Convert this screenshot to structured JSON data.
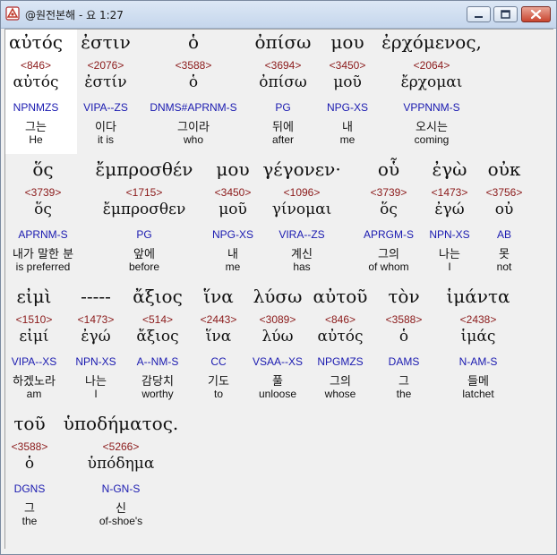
{
  "window": {
    "title": "@원전본해 - 요 1:27",
    "colors": {
      "strong": "#8b1a1a",
      "morph": "#1a1ab0",
      "text": "#111111"
    }
  },
  "verse": {
    "rows": [
      {
        "words": [
          {
            "gk": "αὐτός",
            "strong": "<846>",
            "lemma": "αὐτός",
            "morph": "NPNMZS",
            "ko": "그는",
            "en": "He"
          },
          {
            "gk": "ἐστιν",
            "strong": "<2076>",
            "lemma": "ἐστίν",
            "morph": "VIPA--ZS",
            "ko": "이다",
            "en": "it is"
          },
          {
            "gk": "ὁ",
            "strong": "<3588>",
            "lemma": "ὁ",
            "morph": "DNMS#APRNM-S",
            "ko": "그이라",
            "en": "who"
          },
          {
            "gk": "ὀπίσω",
            "strong": "<3694>",
            "lemma": "ὀπίσω",
            "morph": "PG",
            "ko": "뒤에",
            "en": "after"
          },
          {
            "gk": "μου",
            "strong": "<3450>",
            "lemma": "μοῦ",
            "morph": "NPG-XS",
            "ko": "내",
            "en": "me"
          },
          {
            "gk": "ἐρχόμενος,",
            "strong": "<2064>",
            "lemma": "ἔρχομαι",
            "morph": "VPPNNM-S",
            "ko": "오시는",
            "en": "coming"
          }
        ]
      },
      {
        "words": [
          {
            "gk": "ὅς",
            "strong": "<3739>",
            "lemma": "ὅς",
            "morph": "APRNM-S",
            "ko": "내가 말한 분",
            "en": "is preferred"
          },
          {
            "gk": "ἔμπροσθέν",
            "strong": "<1715>",
            "lemma": "ἔμπροσθεν",
            "morph": "PG",
            "ko": "앞에",
            "en": "before"
          },
          {
            "gk": "μου",
            "strong": "<3450>",
            "lemma": "μοῦ",
            "morph": "NPG-XS",
            "ko": "내",
            "en": "me"
          },
          {
            "gk": "γέγονεν·",
            "strong": "<1096>",
            "lemma": "γίνομαι",
            "morph": "VIRA--ZS",
            "ko": "계신",
            "en": "has"
          },
          {
            "gk": "οὗ",
            "strong": "<3739>",
            "lemma": "ὅς",
            "morph": "APRGM-S",
            "ko": "그의",
            "en": "of whom"
          },
          {
            "gk": "ἐγὼ",
            "strong": "<1473>",
            "lemma": "ἐγώ",
            "morph": "NPN-XS",
            "ko": "나는",
            "en": "I"
          },
          {
            "gk": "οὐκ",
            "strong": "<3756>",
            "lemma": "οὐ",
            "morph": "AB",
            "ko": "못",
            "en": "not"
          }
        ]
      },
      {
        "words": [
          {
            "gk": "εἰμὶ",
            "strong": "<1510>",
            "lemma": "εἰμί",
            "morph": "VIPA--XS",
            "ko": "하겠노라",
            "en": "am"
          },
          {
            "gk": "-----",
            "strong": "<1473>",
            "lemma": "ἐγώ",
            "morph": "NPN-XS",
            "ko": "나는",
            "en": "I"
          },
          {
            "gk": "ἄξιος",
            "strong": "<514>",
            "lemma": "ἄξιος",
            "morph": "A--NM-S",
            "ko": "감당치",
            "en": "worthy"
          },
          {
            "gk": "ἵνα",
            "strong": "<2443>",
            "lemma": "ἵνα",
            "morph": "CC",
            "ko": "기도",
            "en": "to"
          },
          {
            "gk": "λύσω",
            "strong": "<3089>",
            "lemma": "λύω",
            "morph": "VSAA--XS",
            "ko": "풀",
            "en": "unloose"
          },
          {
            "gk": "αὐτοῦ",
            "strong": "<846>",
            "lemma": "αὐτός",
            "morph": "NPGMZS",
            "ko": "그의",
            "en": "whose"
          },
          {
            "gk": "τὸν",
            "strong": "<3588>",
            "lemma": "ὁ",
            "morph": "DAMS",
            "ko": "그",
            "en": "the"
          },
          {
            "gk": "ἱμάντα",
            "strong": "<2438>",
            "lemma": "ἱμάς",
            "morph": "N-AM-S",
            "ko": "들메",
            "en": "latchet"
          }
        ]
      },
      {
        "words": [
          {
            "gk": "τοῦ",
            "strong": "<3588>",
            "lemma": "ὁ",
            "morph": "DGNS",
            "ko": "그",
            "en": "the"
          },
          {
            "gk": "ὑποδήματος.",
            "strong": "<5266>",
            "lemma": "ὑπόδημα",
            "morph": "N-GN-S",
            "ko": "신",
            "en": "of-shoe's"
          }
        ]
      }
    ]
  }
}
